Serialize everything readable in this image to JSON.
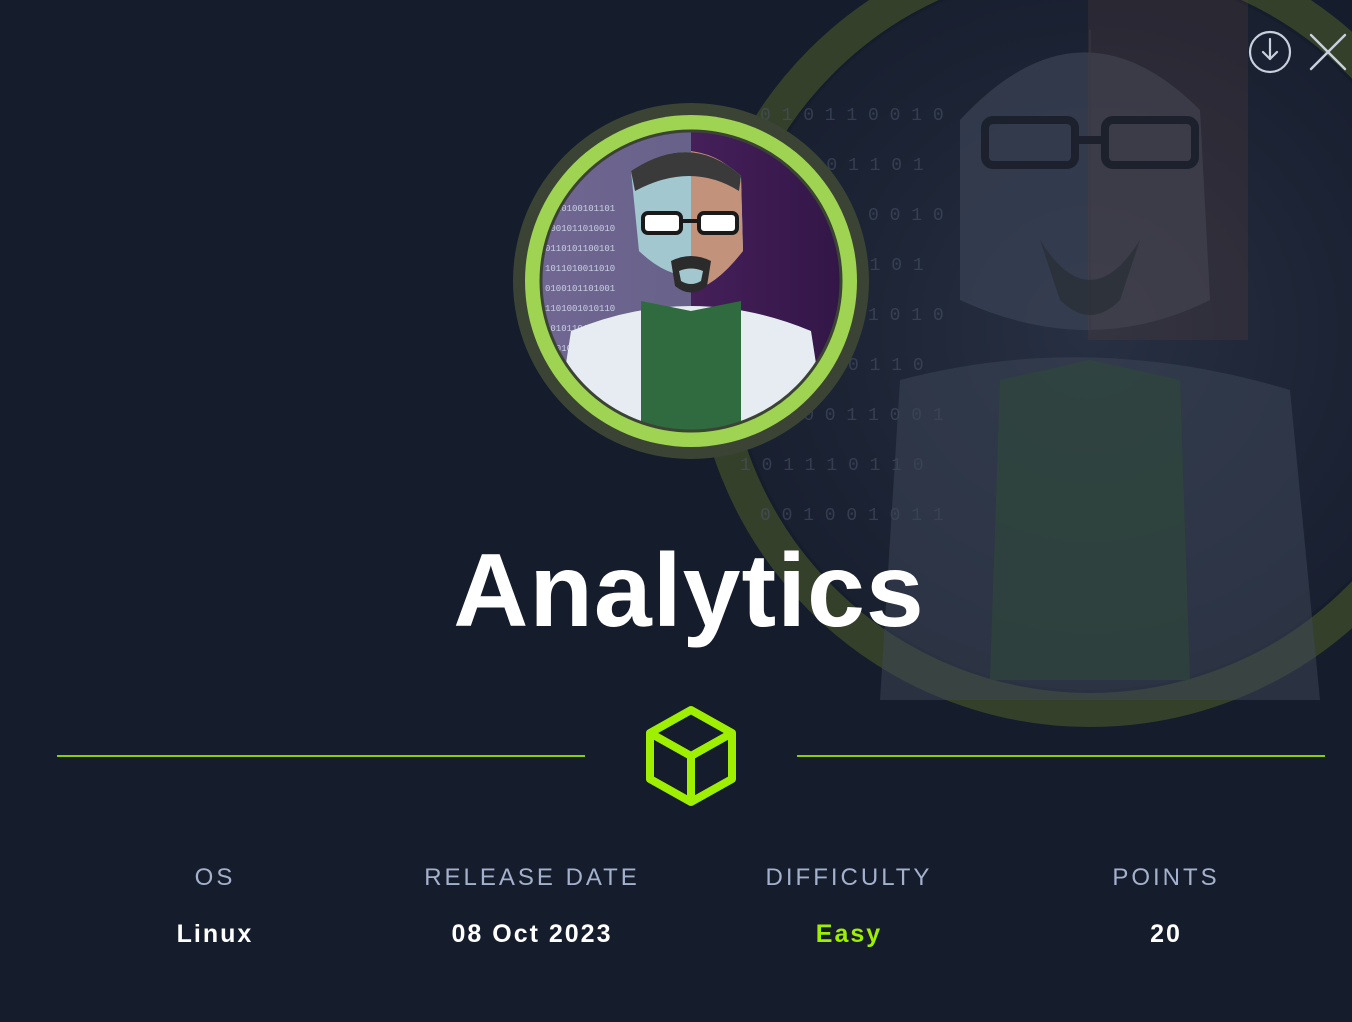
{
  "machine": {
    "name": "Analytics"
  },
  "actions": {
    "download_icon": "download-circle-icon",
    "close_icon": "close-x-icon"
  },
  "stats": [
    {
      "label": "OS",
      "value": "Linux"
    },
    {
      "label": "RELEASE DATE",
      "value": "08 Oct 2023"
    },
    {
      "label": "DIFFICULTY",
      "value": "Easy"
    },
    {
      "label": "POINTS",
      "value": "20"
    }
  ],
  "colors": {
    "background": "#151c2b",
    "accent": "#9fef00",
    "label": "#a4b1cd",
    "text": "#ffffff"
  }
}
